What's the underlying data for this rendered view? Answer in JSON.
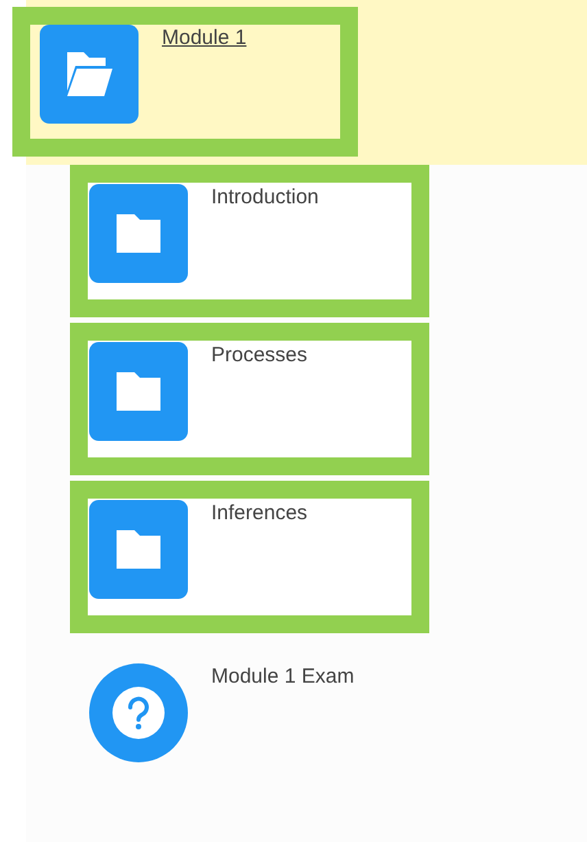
{
  "module": {
    "title": "Module 1",
    "selected": true,
    "expanded": true,
    "highlighted": true,
    "children": [
      {
        "kind": "folder",
        "title": "Introduction",
        "highlighted": true
      },
      {
        "kind": "folder",
        "title": "Processes",
        "highlighted": true
      },
      {
        "kind": "folder",
        "title": "Inferences",
        "highlighted": true
      },
      {
        "kind": "quiz",
        "title": "Module 1 Exam",
        "highlighted": false
      }
    ]
  }
}
